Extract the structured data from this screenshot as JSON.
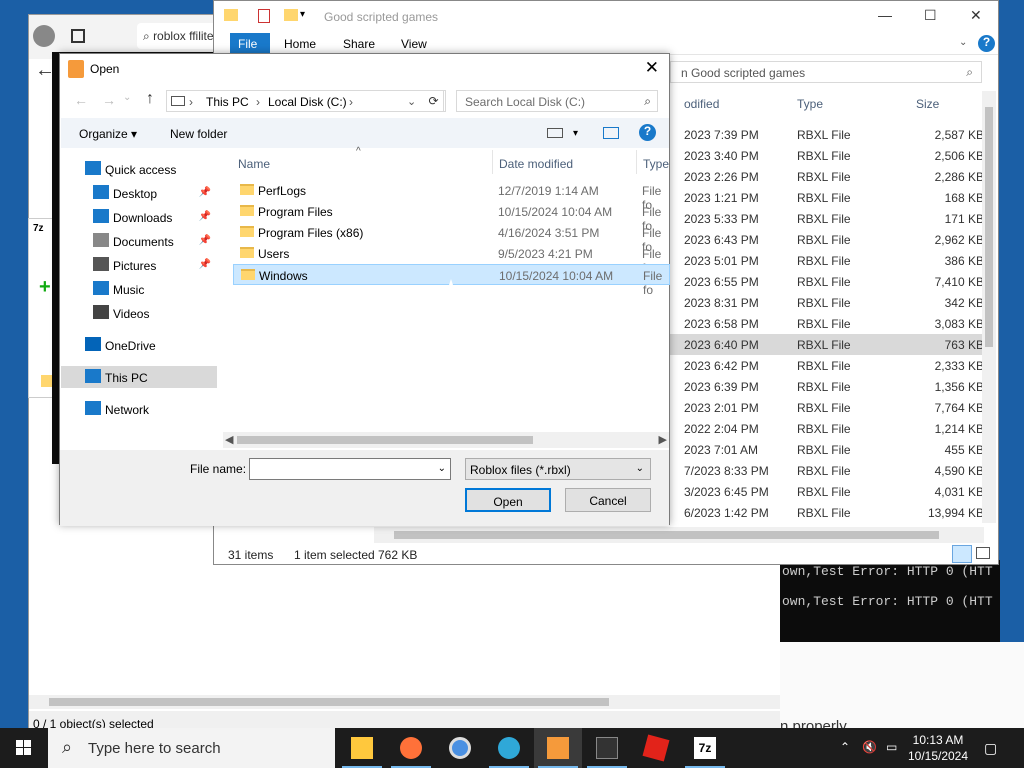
{
  "browser": {
    "url_text": "roblox ffiliteri",
    "status": "0 / 1 object(s) selected",
    "bottom_text": "n properly"
  },
  "console": {
    "line1": "own,Test Error: HTTP 0 (HTT",
    "line2": "own,Test Error: HTTP 0 (HTT"
  },
  "explorer": {
    "title": "Good scripted games",
    "tabs": [
      "File",
      "Home",
      "Share",
      "View"
    ],
    "search_placeholder": "n Good scripted games",
    "columns": [
      "odified",
      "Type",
      "Size"
    ],
    "rows": [
      {
        "date": "2023 7:39 PM",
        "type": "RBXL File",
        "size": "2,587 KB"
      },
      {
        "date": "2023 3:40 PM",
        "type": "RBXL File",
        "size": "2,506 KB"
      },
      {
        "date": "2023 2:26 PM",
        "type": "RBXL File",
        "size": "2,286 KB"
      },
      {
        "date": "2023 1:21 PM",
        "type": "RBXL File",
        "size": "168 KB"
      },
      {
        "date": "2023 5:33 PM",
        "type": "RBXL File",
        "size": "171 KB"
      },
      {
        "date": "2023 6:43 PM",
        "type": "RBXL File",
        "size": "2,962 KB"
      },
      {
        "date": "2023 5:01 PM",
        "type": "RBXL File",
        "size": "386 KB"
      },
      {
        "date": "2023 6:55 PM",
        "type": "RBXL File",
        "size": "7,410 KB"
      },
      {
        "date": "2023 8:31 PM",
        "type": "RBXL File",
        "size": "342 KB"
      },
      {
        "date": "2023 6:58 PM",
        "type": "RBXL File",
        "size": "3,083 KB"
      },
      {
        "date": "2023 6:40 PM",
        "type": "RBXL File",
        "size": "763 KB"
      },
      {
        "date": "2023 6:42 PM",
        "type": "RBXL File",
        "size": "2,333 KB"
      },
      {
        "date": "2023 6:39 PM",
        "type": "RBXL File",
        "size": "1,356 KB"
      },
      {
        "date": "2023 2:01 PM",
        "type": "RBXL File",
        "size": "7,764 KB"
      },
      {
        "date": "2022 2:04 PM",
        "type": "RBXL File",
        "size": "1,214 KB"
      },
      {
        "date": "2023 7:01 AM",
        "type": "RBXL File",
        "size": "455 KB"
      },
      {
        "date": "7/2023 8:33 PM",
        "type": "RBXL File",
        "size": "4,590 KB"
      },
      {
        "date": "3/2023 6:45 PM",
        "type": "RBXL File",
        "size": "4,031 KB"
      },
      {
        "date": "6/2023 1:42 PM",
        "type": "RBXL File",
        "size": "13,994 KB"
      }
    ],
    "status_items": "31 items",
    "status_selected": "1 item selected",
    "status_size": "762 KB"
  },
  "dialog": {
    "title": "Open",
    "breadcrumb": [
      "This PC",
      "Local Disk (C:)"
    ],
    "search_placeholder": "Search Local Disk (C:)",
    "organize": "Organize ▾",
    "new_folder": "New folder",
    "nav": [
      {
        "label": "Quick access",
        "icon": "star-icon"
      },
      {
        "label": "Desktop",
        "icon": "desktop-icon"
      },
      {
        "label": "Downloads",
        "icon": "downloads-icon"
      },
      {
        "label": "Documents",
        "icon": "documents-icon"
      },
      {
        "label": "Pictures",
        "icon": "pictures-icon"
      },
      {
        "label": "Music",
        "icon": "music-icon"
      },
      {
        "label": "Videos",
        "icon": "videos-icon"
      },
      {
        "label": "OneDrive",
        "icon": "onedrive-icon"
      },
      {
        "label": "This PC",
        "icon": "pc-icon"
      },
      {
        "label": "Network",
        "icon": "network-icon"
      }
    ],
    "columns": [
      "Name",
      "Date modified",
      "Type"
    ],
    "files": [
      {
        "name": "PerfLogs",
        "date": "12/7/2019 1:14 AM",
        "type": "File fo"
      },
      {
        "name": "Program Files",
        "date": "10/15/2024 10:04 AM",
        "type": "File fo"
      },
      {
        "name": "Program Files (x86)",
        "date": "4/16/2024 3:51 PM",
        "type": "File fo"
      },
      {
        "name": "Users",
        "date": "9/5/2023 4:21 PM",
        "type": "File fo"
      },
      {
        "name": "Windows",
        "date": "10/15/2024 10:04 AM",
        "type": "File fo"
      }
    ],
    "file_name_label": "File name:",
    "file_name_value": "",
    "file_type": "Roblox files (*.rbxl)",
    "open_label": "Open",
    "cancel_label": "Cancel"
  },
  "taskbar": {
    "search_placeholder": "Type here to search",
    "time": "10:13 AM",
    "date": "10/15/2024"
  },
  "colors": {
    "accent": "#0078d7",
    "taskbar": "#1c1c1c",
    "selection": "#cce8ff"
  }
}
